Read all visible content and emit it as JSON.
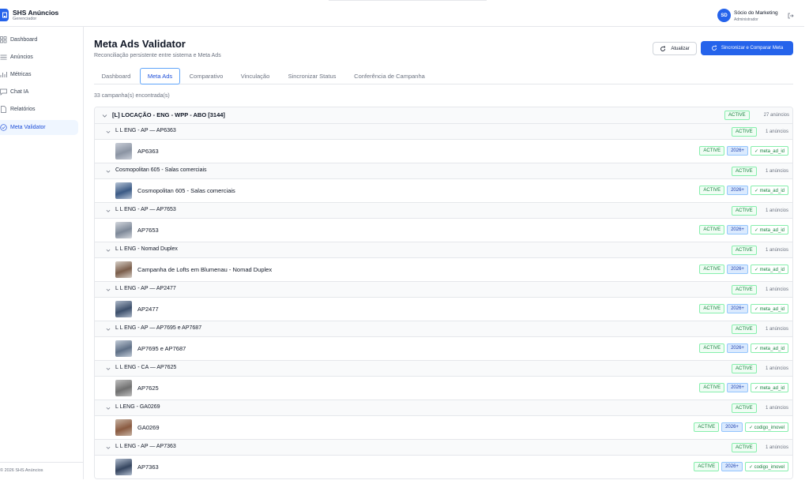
{
  "app": {
    "name": "SHS Anúncios",
    "subtitle": "Gerenciador",
    "footer": "© 2026 SHS Anúncios"
  },
  "user": {
    "initials": "SD",
    "name": "Sócio do Marketing",
    "role": "Administrador"
  },
  "sidebar": {
    "items": [
      {
        "label": "Dashboard",
        "icon": "grid-icon",
        "active": false
      },
      {
        "label": "Anúncios",
        "icon": "list-icon",
        "active": false
      },
      {
        "label": "Métricas",
        "icon": "chart-icon",
        "active": false
      },
      {
        "label": "Chat IA",
        "icon": "chat-icon",
        "active": false
      },
      {
        "label": "Relatórios",
        "icon": "report-icon",
        "active": false
      },
      {
        "label": "Meta Validator",
        "icon": "check-circle-icon",
        "active": true
      }
    ]
  },
  "header": {
    "title": "Meta Ads Validator",
    "subtitle": "Reconciliação persistente entre sistema e Meta Ads",
    "refresh_label": "Atualizar",
    "sync_label": "Sincronizar e Comparar Meta"
  },
  "tabs": [
    {
      "label": "Dashboard",
      "active": false
    },
    {
      "label": "Meta Ads",
      "active": true
    },
    {
      "label": "Comparativo",
      "active": false
    },
    {
      "label": "Vinculação",
      "active": false
    },
    {
      "label": "Sincronizar Status",
      "active": false
    },
    {
      "label": "Conferência de Campanha",
      "active": false
    }
  ],
  "count_text": "33 campanha(s) encontrada(s)",
  "campaign": {
    "title": "[L] LOCAÇÃO - ENG - WPP - ABO [3144]",
    "status": "ACTIVE",
    "ads_count": "27 anúncios"
  },
  "adsets": [
    {
      "title": "L L ENG - AP — AP6363",
      "status": "ACTIVE",
      "ads_count": "1 anúncios",
      "ad": {
        "name": "AP6363",
        "status": "ACTIVE",
        "year": "2026+",
        "match": "✓ meta_ad_id"
      }
    },
    {
      "title": "Cosmopolitan 605 - Salas comerciais",
      "status": "ACTIVE",
      "ads_count": "1 anúncios",
      "ad": {
        "name": "Cosmopolitan 605 - Salas comerciais",
        "status": "ACTIVE",
        "year": "2026+",
        "match": "✓ meta_ad_id"
      }
    },
    {
      "title": "L L ENG - AP — AP7653",
      "status": "ACTIVE",
      "ads_count": "1 anúncios",
      "ad": {
        "name": "AP7653",
        "status": "ACTIVE",
        "year": "2026+",
        "match": "✓ meta_ad_id"
      }
    },
    {
      "title": "L L ENG - Nomad Duplex",
      "status": "ACTIVE",
      "ads_count": "1 anúncios",
      "ad": {
        "name": "Campanha de Lofts em Blumenau - Nomad Duplex",
        "status": "ACTIVE",
        "year": "2026+",
        "match": "✓ meta_ad_id"
      }
    },
    {
      "title": "L L ENG - AP — AP2477",
      "status": "ACTIVE",
      "ads_count": "1 anúncios",
      "ad": {
        "name": "AP2477",
        "status": "ACTIVE",
        "year": "2026+",
        "match": "✓ meta_ad_id"
      }
    },
    {
      "title": "L L ENG - AP — AP7695 e AP7687",
      "status": "ACTIVE",
      "ads_count": "1 anúncios",
      "ad": {
        "name": "AP7695 e AP7687",
        "status": "ACTIVE",
        "year": "2026+",
        "match": "✓ meta_ad_id"
      }
    },
    {
      "title": "L L ENG - CA — AP7625",
      "status": "ACTIVE",
      "ads_count": "1 anúncios",
      "ad": {
        "name": "AP7625",
        "status": "ACTIVE",
        "year": "2026+",
        "match": "✓ meta_ad_id"
      }
    },
    {
      "title": "L LENG - GA0269",
      "status": "ACTIVE",
      "ads_count": "1 anúncios",
      "ad": {
        "name": "GA0269",
        "status": "ACTIVE",
        "year": "2026+",
        "match": "✓ codigo_imovel"
      }
    },
    {
      "title": "L L ENG - AP — AP7363",
      "status": "ACTIVE",
      "ads_count": "1 anúncios",
      "ad": {
        "name": "AP7363",
        "status": "ACTIVE",
        "year": "2026+",
        "match": "✓ codigo_imovel"
      }
    }
  ],
  "colors": {
    "accent": "#2563eb",
    "active_green": "#15803d",
    "year_blue": "#1e40af"
  }
}
